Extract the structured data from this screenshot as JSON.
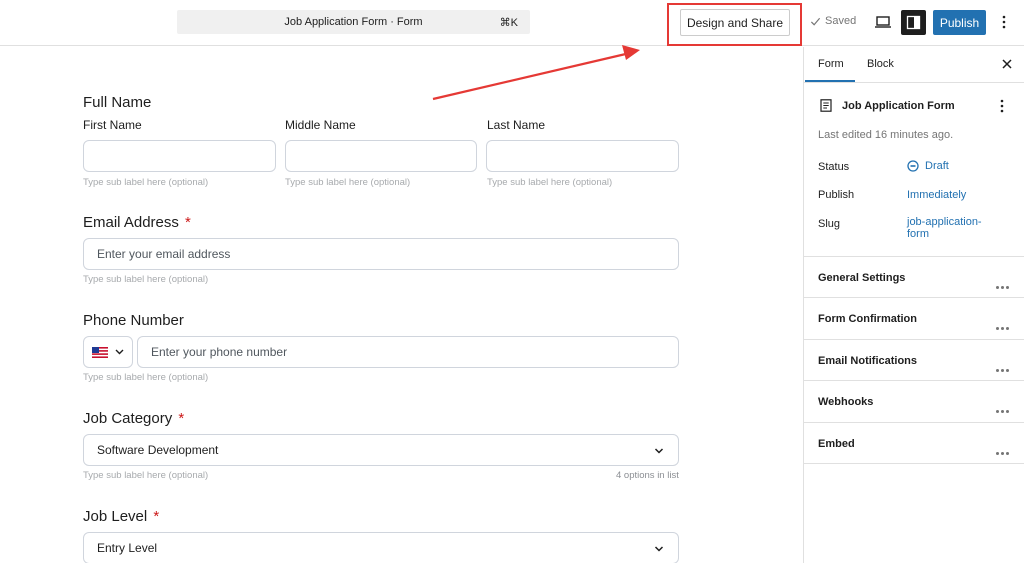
{
  "topbar": {
    "command_title": "Job Application Form · Form",
    "command_shortcut": "⌘K",
    "design_share_label": "Design and Share",
    "saved_label": "Saved",
    "publish_label": "Publish"
  },
  "form": {
    "full_name": {
      "heading": "Full Name",
      "first_label": "First Name",
      "middle_label": "Middle Name",
      "last_label": "Last Name",
      "hint": "Type sub label here (optional)"
    },
    "email": {
      "heading": "Email Address",
      "required_mark": "*",
      "placeholder": "Enter your email address",
      "hint": "Type sub label here (optional)"
    },
    "phone": {
      "heading": "Phone Number",
      "country_flag": "🇺🇸",
      "placeholder": "Enter your phone number",
      "hint": "Type sub label here (optional)"
    },
    "job_category": {
      "heading": "Job Category",
      "required_mark": "*",
      "selected": "Software Development",
      "hint": "Type sub label here (optional)",
      "options_count": "4 options in list"
    },
    "job_level": {
      "heading": "Job Level",
      "required_mark": "*",
      "selected": "Entry Level"
    }
  },
  "sidebar": {
    "tab_form": "Form",
    "tab_block": "Block",
    "doc_title": "Job Application Form",
    "last_edited": "Last edited 16 minutes ago.",
    "status_label": "Status",
    "status_value": "Draft",
    "publish_label": "Publish",
    "publish_value": "Immediately",
    "slug_label": "Slug",
    "slug_value_1": "job-application-",
    "slug_value_2": "form",
    "sections": [
      {
        "label": "General Settings"
      },
      {
        "label": "Form Confirmation"
      },
      {
        "label": "Email Notifications"
      },
      {
        "label": "Webhooks"
      },
      {
        "label": "Embed"
      }
    ]
  },
  "colors": {
    "accent": "#2271b1",
    "required": "#cc1818",
    "annotation": "#e53935"
  }
}
